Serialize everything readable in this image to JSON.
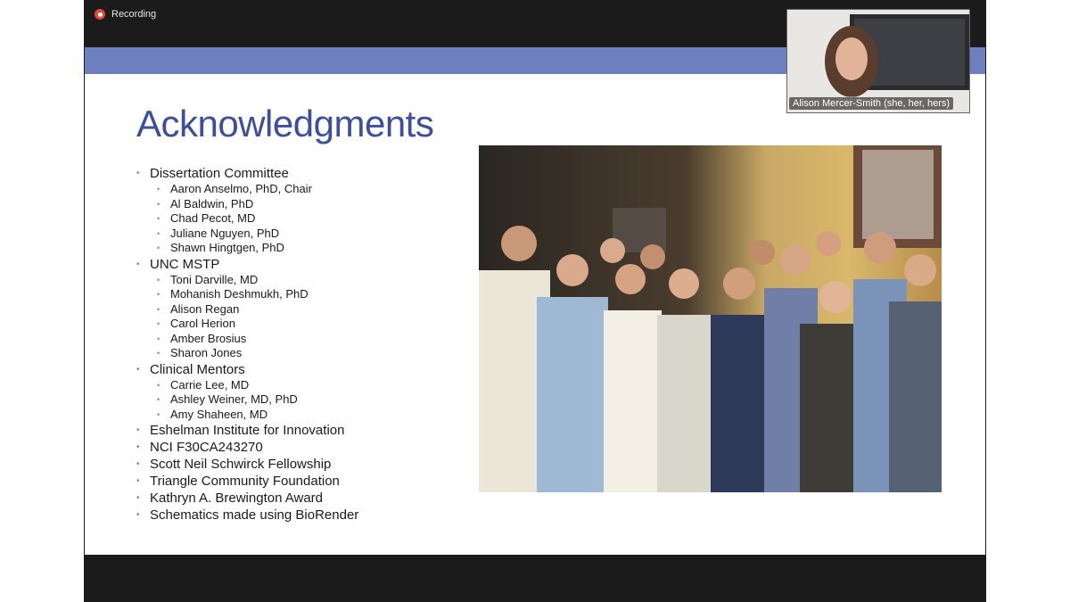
{
  "recording": {
    "label": "Recording"
  },
  "camera": {
    "participant_name": "Alison Mercer-Smith (she, her, hers)"
  },
  "slide": {
    "title": "Acknowledgments",
    "sections": [
      {
        "label": "Dissertation Committee",
        "items": [
          "Aaron Anselmo, PhD, Chair",
          "Al Baldwin, PhD",
          "Chad Pecot, MD",
          "Juliane Nguyen, PhD",
          "Shawn Hingtgen, PhD"
        ]
      },
      {
        "label": "UNC MSTP",
        "items": [
          "Toni Darville, MD",
          "Mohanish Deshmukh, PhD",
          "Alison Regan",
          "Carol Herion",
          "Amber Brosius",
          "Sharon Jones"
        ]
      },
      {
        "label": "Clinical Mentors",
        "items": [
          "Carrie Lee, MD",
          "Ashley Weiner, MD, PhD",
          "Amy Shaheen, MD"
        ]
      },
      {
        "label": "Eshelman Institute for Innovation",
        "items": []
      },
      {
        "label": "NCI F30CA243270",
        "items": []
      },
      {
        "label": "Scott Neil Schwirck Fellowship",
        "items": []
      },
      {
        "label": "Triangle Community Foundation",
        "items": []
      },
      {
        "label": "Kathryn A. Brewington Award",
        "items": []
      },
      {
        "label": "Schematics made using BioRender",
        "items": []
      }
    ]
  },
  "colors": {
    "title": "#3c4f9e",
    "band": "#6d7fbf",
    "recording_dot": "#e2483d"
  }
}
